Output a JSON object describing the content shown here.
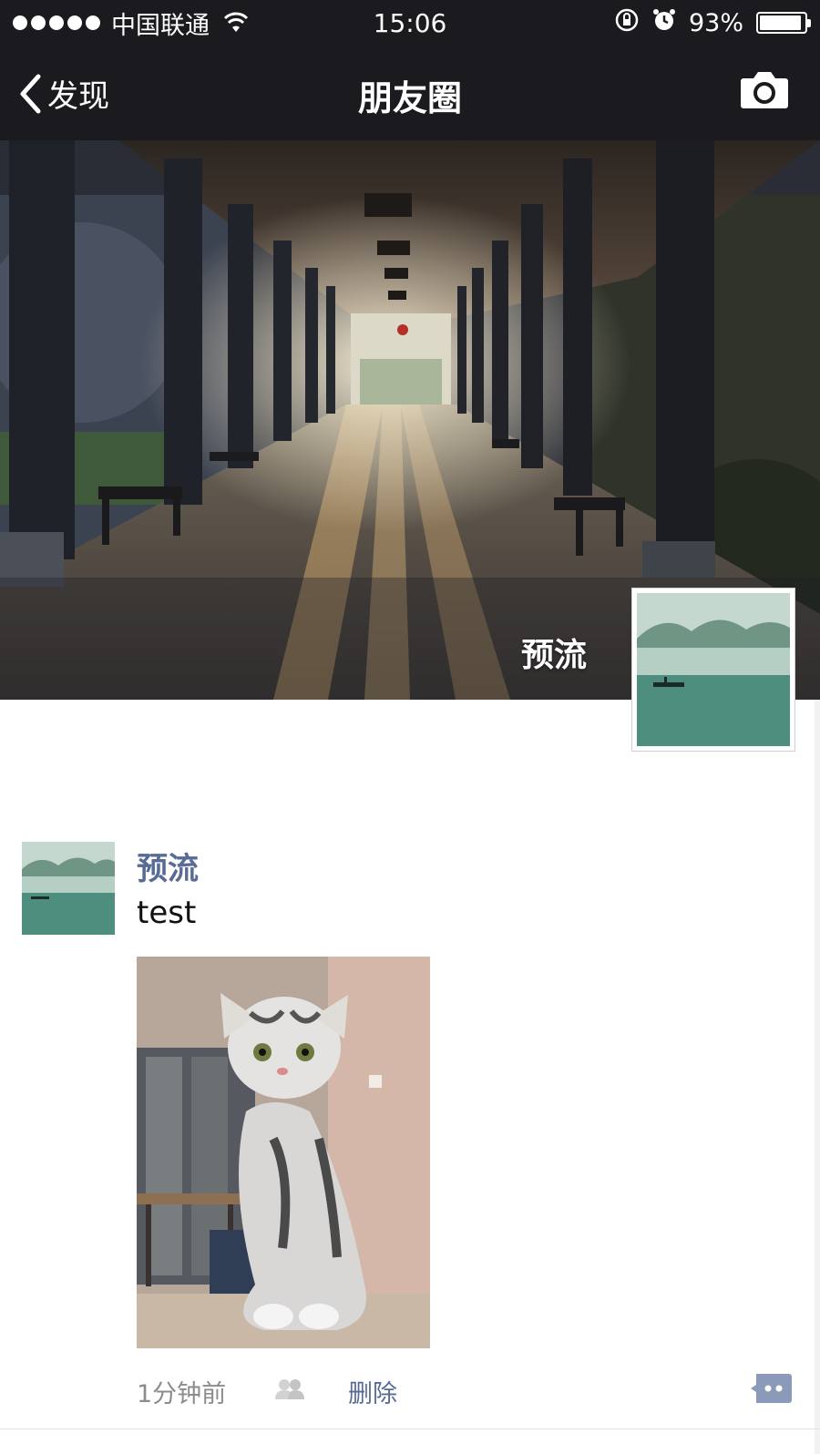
{
  "status_bar": {
    "carrier": "中国联通",
    "time": "15:06",
    "battery": "93%",
    "battery_level": 0.93
  },
  "nav": {
    "back_label": "发现",
    "title": "朋友圈"
  },
  "cover": {
    "user_name": "预流"
  },
  "post": {
    "author": "预流",
    "text": "test",
    "time_ago": "1分钟前",
    "delete_label": "删除"
  },
  "icons": [
    "signal-dots-icon",
    "wifi-icon",
    "rotation-lock-icon",
    "alarm-icon",
    "battery-icon",
    "back-chevron-icon",
    "camera-icon",
    "friends-visibility-icon",
    "comment-icon"
  ],
  "colors": {
    "bar_background": "#1b1b1f",
    "link_blue": "#576b95",
    "meta_gray": "#8c8c8c"
  }
}
